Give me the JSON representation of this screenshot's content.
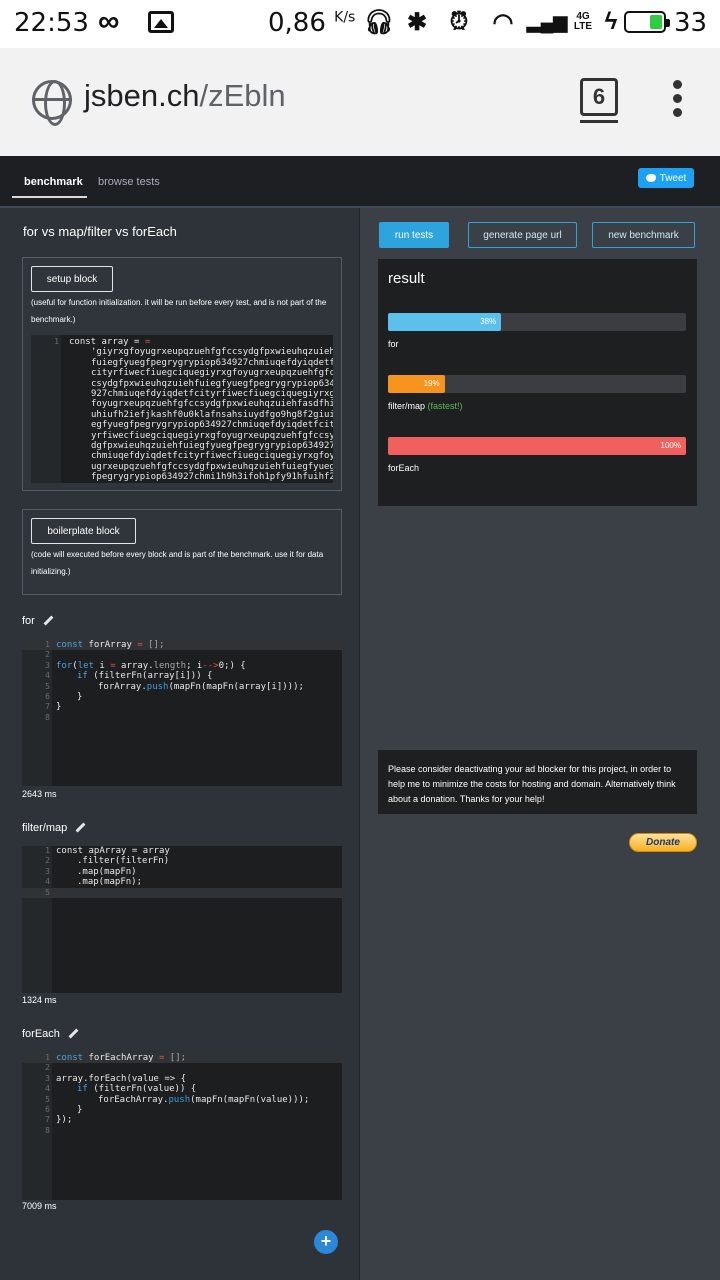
{
  "status_bar": {
    "time": "22:53",
    "speed_value": "0,86",
    "speed_unit": "K/s",
    "network_type": "4G LTE",
    "battery_level": "33",
    "icons": [
      "infinity-icon",
      "gallery-icon",
      "headset-icon",
      "bluetooth-icon",
      "alarm-icon",
      "wifi-icon",
      "signal-icon",
      "charging-icon",
      "battery-icon"
    ]
  },
  "browser": {
    "url_host": "jsben.ch",
    "url_path": "/zEbln",
    "tab_count": "6"
  },
  "nav": {
    "items": [
      {
        "label": "benchmark",
        "active": true
      },
      {
        "label": "browse tests",
        "active": false
      }
    ],
    "tweet_label": "Tweet"
  },
  "page": {
    "title": "for vs map/filter vs forEach"
  },
  "setup_block": {
    "button_label": "setup block",
    "note": "(useful for function initialization. it will be run before every test, and is not part of the benchmark.)",
    "code_line_number": "1",
    "code_head": "const array = ",
    "string_lines": [
      "'giyrxgfoyugrxeupqzuehfgfccsydgfpxwieuhqzuieh",
      "fuiegfyuegfpegrygrypiop634927chmiuqefdyiqdetf",
      "cityrfiwecfiuegciquegiyrxgfoyugrxeupqzuehfgfc",
      "csydgfpxwieuhqzuiehfuiegfyuegfpegrygrypiop634",
      "927chmiuqefdyiqdetfcityrfiwecfiuegciquegiyrxg",
      "foyugrxeupqzuehfgfccsydgfpxwieuhqzuiehfasdfhi",
      "uhiufh2iefjkashf0u0klafnsahsiuydfgo9hg8f2giui",
      "egfyuegfpegrygrypiop634927chmiuqefdyiqdetfcit",
      "yrfiwecfiuegciquegiyrxgfoyugrxeupqzuehfgfccsy",
      "dgfpxwieuhqzuiehfuiegfyuegfpegrygrypiop634927",
      "chmiuqefdyiqdetfcityrfiwecfiuegciquegiyrxgfoy",
      "ugrxeupqzuehfgfccsydgfpxwieuhqzuiehfuiegfyueg",
      "fpegrygrypiop634927chmi1h9h3ifoh1pfy91hfuihf2"
    ]
  },
  "boilerplate_block": {
    "button_label": "boilerplate block",
    "note": "(code will executed before every block and is part of the benchmark. use it for data initializing.)"
  },
  "tests": [
    {
      "name": "for",
      "time": "2643 ms",
      "line_numbers": [
        "1",
        "2",
        "3",
        "4",
        "5",
        "6",
        "7",
        "8"
      ],
      "code": {
        "l1_kw": "const",
        "l1_name": " forArray ",
        "l1_op": "=",
        "l1_tail": " [];",
        "l3_for": "for",
        "l3_a": "(",
        "l3_let": "let",
        "l3_b": " i ",
        "l3_eq": "=",
        "l3_c": " array.",
        "l3_len": "length",
        "l3_d": "; i",
        "l3_op": "-->",
        "l3_e": "0;) {",
        "l4_if": "if",
        "l4_rest": " (filterFn(array[i])) {",
        "l5_a": "forArray.",
        "l5_push": "push",
        "l5_b": "(mapFn(mapFn(array[i])));",
        "l6": "}",
        "l7": "}"
      }
    },
    {
      "name": "filter/map",
      "time": "1324 ms",
      "line_numbers": [
        "1",
        "2",
        "3",
        "4",
        "5"
      ],
      "code": {
        "l1": "const apArray = array",
        "l2": ".filter(filterFn)",
        "l3": ".map(mapFn)",
        "l4": ".map(mapFn);"
      }
    },
    {
      "name": "forEach",
      "time": "7009 ms",
      "line_numbers": [
        "1",
        "2",
        "3",
        "4",
        "5",
        "6",
        "7",
        "8"
      ],
      "code": {
        "l1_kw": "const",
        "l1_name": " forEachArray ",
        "l1_op": "=",
        "l1_tail": " [];",
        "l3": "array.forEach(value => {",
        "l4_if": "if",
        "l4_rest": " (filterFn(value)) {",
        "l5_a": "forEachArray.",
        "l5_push": "push",
        "l5_b": "(mapFn(mapFn(value)));",
        "l6": "}",
        "l7": "});"
      }
    }
  ],
  "actions": {
    "run_tests": "run tests",
    "generate_url": "generate page url",
    "new_benchmark": "new benchmark",
    "add_test": "+"
  },
  "result": {
    "title": "result",
    "fastest_note": "(fastest!)",
    "bars": [
      {
        "name": "for",
        "percent_label": "38%",
        "value": 0.38,
        "color": "#5bc0eb"
      },
      {
        "name": "filter/map",
        "percent_label": "19%",
        "value": 0.19,
        "color": "#f7941d"
      },
      {
        "name": "forEach",
        "percent_label": "100%",
        "value": 1.0,
        "color": "#f0605d"
      }
    ]
  },
  "ad_note": "Please consider deactivating your ad blocker for this project, in order to help me to minimize the costs for hosting and domain. Alternatively think about a donation. Thanks for your help!",
  "donate_label": "Donate"
}
